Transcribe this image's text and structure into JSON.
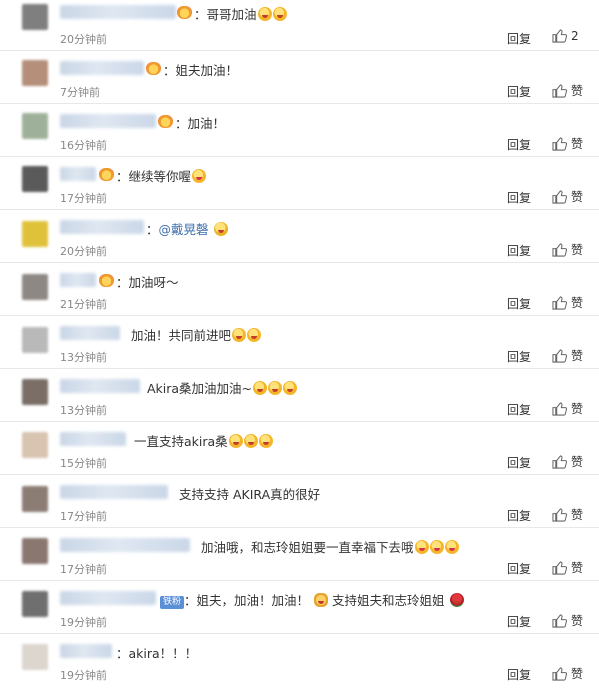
{
  "comments": [
    {
      "text": "：哥哥加油",
      "emojis": [
        "face",
        "face"
      ],
      "time": "20分钟前",
      "reply": "回复",
      "like": "2"
    },
    {
      "text": "：姐夫加油！",
      "emojis": [],
      "time": "7分钟前",
      "reply": "回复",
      "like": "赞"
    },
    {
      "text": "：加油！",
      "emojis": [],
      "time": "16分钟前",
      "reply": "回复",
      "like": "赞"
    },
    {
      "text": "：继续等你喔",
      "emojis": [
        "heart"
      ],
      "time": "17分钟前",
      "reply": "回复",
      "like": "赞"
    },
    {
      "text_prefix": "：",
      "mention": "@戴晃磬",
      "emojis": [
        "grin"
      ],
      "time": "20分钟前",
      "reply": "回复",
      "like": "赞"
    },
    {
      "text": "：加油呀～",
      "emojis": [],
      "time": "21分钟前",
      "reply": "回复",
      "like": "赞"
    },
    {
      "text": "加油！共同前进吧",
      "emojis": [
        "face",
        "face"
      ],
      "time": "13分钟前",
      "reply": "回复",
      "like": "赞"
    },
    {
      "text": "Akira桑加油加油~",
      "emojis": [
        "face",
        "face",
        "face"
      ],
      "time": "13分钟前",
      "reply": "回复",
      "like": "赞"
    },
    {
      "text": "一直支持akira桑",
      "emojis": [
        "face",
        "face",
        "face"
      ],
      "time": "15分钟前",
      "reply": "回复",
      "like": "赞"
    },
    {
      "text": "支持支持 AKIRA真的很好",
      "emojis": [],
      "time": "17分钟前",
      "reply": "回复",
      "like": "赞"
    },
    {
      "text": "加油哦，和志玲姐姐要一直幸福下去哦",
      "emojis": [
        "heart",
        "heart",
        "heart"
      ],
      "time": "17分钟前",
      "reply": "回复",
      "like": "赞"
    },
    {
      "fan_badge": "铁粉",
      "text": "：姐夫，加油！加油！",
      "text2": "支持姐夫和志玲姐姐",
      "emojis": [
        "clap"
      ],
      "emojis2": [
        "rose"
      ],
      "time": "19分钟前",
      "reply": "回复",
      "like": "赞"
    },
    {
      "text": "：akira！！！",
      "emojis": [],
      "time": "19分钟前",
      "reply": "回复",
      "like": "赞"
    }
  ]
}
